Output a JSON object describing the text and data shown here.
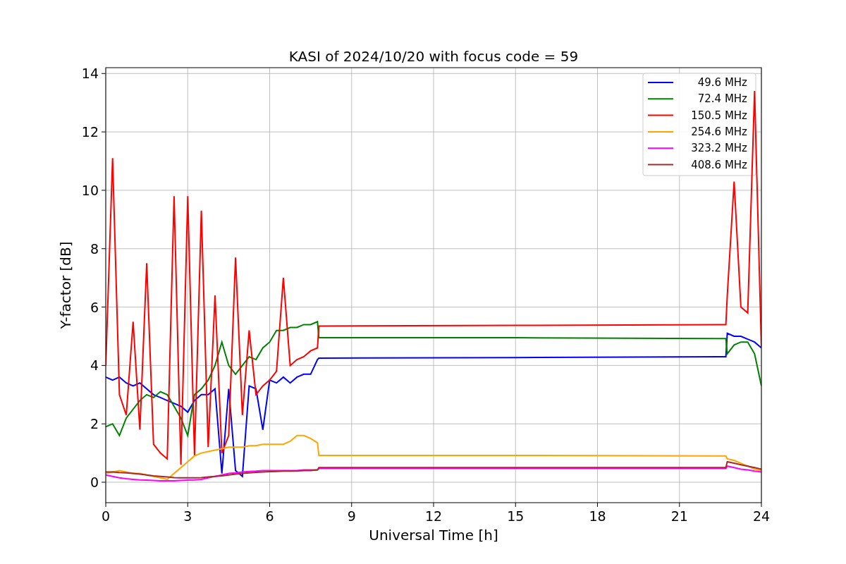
{
  "chart_data": {
    "type": "line",
    "title": "KASI of 2024/10/20 with focus code = 59",
    "xlabel": "Universal Time [h]",
    "ylabel": "Y-factor [dB]",
    "x": [
      0,
      0.25,
      0.5,
      0.75,
      1,
      1.25,
      1.5,
      1.75,
      2,
      2.25,
      2.5,
      2.75,
      3,
      3.25,
      3.5,
      3.75,
      4,
      4.25,
      4.5,
      4.75,
      5,
      5.25,
      5.5,
      5.75,
      6,
      6.25,
      6.5,
      6.75,
      7,
      7.25,
      7.5,
      7.75,
      7.8,
      15,
      22.7,
      22.75,
      23,
      23.25,
      23.5,
      23.75,
      24
    ],
    "series": [
      {
        "name": " 49.6 MHz",
        "color": "#0000ff",
        "values": [
          3.6,
          3.5,
          3.6,
          3.4,
          3.3,
          3.4,
          3.2,
          3.0,
          2.9,
          2.8,
          2.7,
          2.6,
          2.4,
          2.8,
          3.0,
          3.0,
          3.2,
          0.3,
          3.2,
          0.4,
          0.2,
          3.3,
          3.2,
          1.8,
          3.5,
          3.4,
          3.6,
          3.4,
          3.6,
          3.7,
          3.7,
          4.2,
          4.25,
          4.27,
          4.3,
          5.1,
          5.0,
          5.0,
          4.9,
          4.8,
          4.6
        ]
      },
      {
        "name": " 72.4 MHz",
        "color": "#008000",
        "values": [
          1.9,
          2.0,
          1.6,
          2.2,
          2.5,
          2.8,
          3.0,
          2.9,
          3.1,
          3.0,
          2.6,
          2.2,
          1.6,
          3.0,
          3.2,
          3.5,
          4.0,
          4.8,
          4.0,
          3.7,
          4.0,
          4.3,
          4.2,
          4.6,
          4.8,
          5.2,
          5.2,
          5.3,
          5.3,
          5.4,
          5.4,
          5.5,
          4.95,
          4.95,
          4.92,
          4.4,
          4.7,
          4.8,
          4.8,
          4.4,
          3.3
        ]
      },
      {
        "name": "150.5 MHz",
        "color": "#ff0000",
        "values": [
          4.0,
          11.1,
          3.0,
          2.3,
          5.5,
          1.8,
          7.5,
          1.3,
          1.0,
          0.8,
          9.8,
          0.6,
          9.8,
          0.9,
          9.3,
          1.2,
          6.4,
          1.0,
          1.6,
          7.7,
          2.3,
          5.2,
          3.0,
          3.3,
          3.5,
          3.8,
          7.0,
          4.0,
          4.2,
          4.3,
          4.5,
          4.6,
          5.35,
          5.37,
          5.4,
          6.4,
          10.3,
          6.0,
          5.8,
          13.4,
          4.6
        ]
      },
      {
        "name": "254.6 MHz",
        "color": "#ffa500",
        "values": [
          0.3,
          0.35,
          0.4,
          0.35,
          0.3,
          0.3,
          0.25,
          0.2,
          0.15,
          0.1,
          0.3,
          0.5,
          0.7,
          0.9,
          1.0,
          1.05,
          1.1,
          1.15,
          1.2,
          1.2,
          1.2,
          1.25,
          1.25,
          1.3,
          1.3,
          1.3,
          1.3,
          1.4,
          1.6,
          1.6,
          1.5,
          1.35,
          0.92,
          0.92,
          0.9,
          0.8,
          0.75,
          0.65,
          0.55,
          0.45,
          0.4
        ]
      },
      {
        "name": "323.2 MHz",
        "color": "#ff00ff",
        "values": [
          0.25,
          0.2,
          0.15,
          0.12,
          0.1,
          0.08,
          0.07,
          0.06,
          0.05,
          0.05,
          0.05,
          0.06,
          0.07,
          0.08,
          0.1,
          0.15,
          0.2,
          0.25,
          0.3,
          0.32,
          0.35,
          0.37,
          0.38,
          0.4,
          0.4,
          0.4,
          0.4,
          0.4,
          0.4,
          0.42,
          0.42,
          0.42,
          0.47,
          0.47,
          0.47,
          0.55,
          0.5,
          0.45,
          0.42,
          0.38,
          0.35
        ]
      },
      {
        "name": "408.6 MHz",
        "color": "#a52a2a",
        "values": [
          0.35,
          0.35,
          0.33,
          0.32,
          0.3,
          0.28,
          0.25,
          0.22,
          0.2,
          0.18,
          0.16,
          0.15,
          0.15,
          0.15,
          0.16,
          0.18,
          0.2,
          0.22,
          0.25,
          0.28,
          0.3,
          0.32,
          0.34,
          0.35,
          0.36,
          0.37,
          0.38,
          0.38,
          0.39,
          0.4,
          0.4,
          0.42,
          0.5,
          0.5,
          0.5,
          0.7,
          0.65,
          0.6,
          0.55,
          0.5,
          0.45
        ]
      }
    ],
    "grid": true,
    "legend": true,
    "xlim": [
      0,
      24
    ],
    "ylim": [
      -0.7,
      14.2
    ],
    "xticks": [
      0,
      3,
      6,
      9,
      12,
      15,
      18,
      21,
      24
    ],
    "yticks": [
      0,
      2,
      4,
      6,
      8,
      10,
      12,
      14
    ]
  }
}
